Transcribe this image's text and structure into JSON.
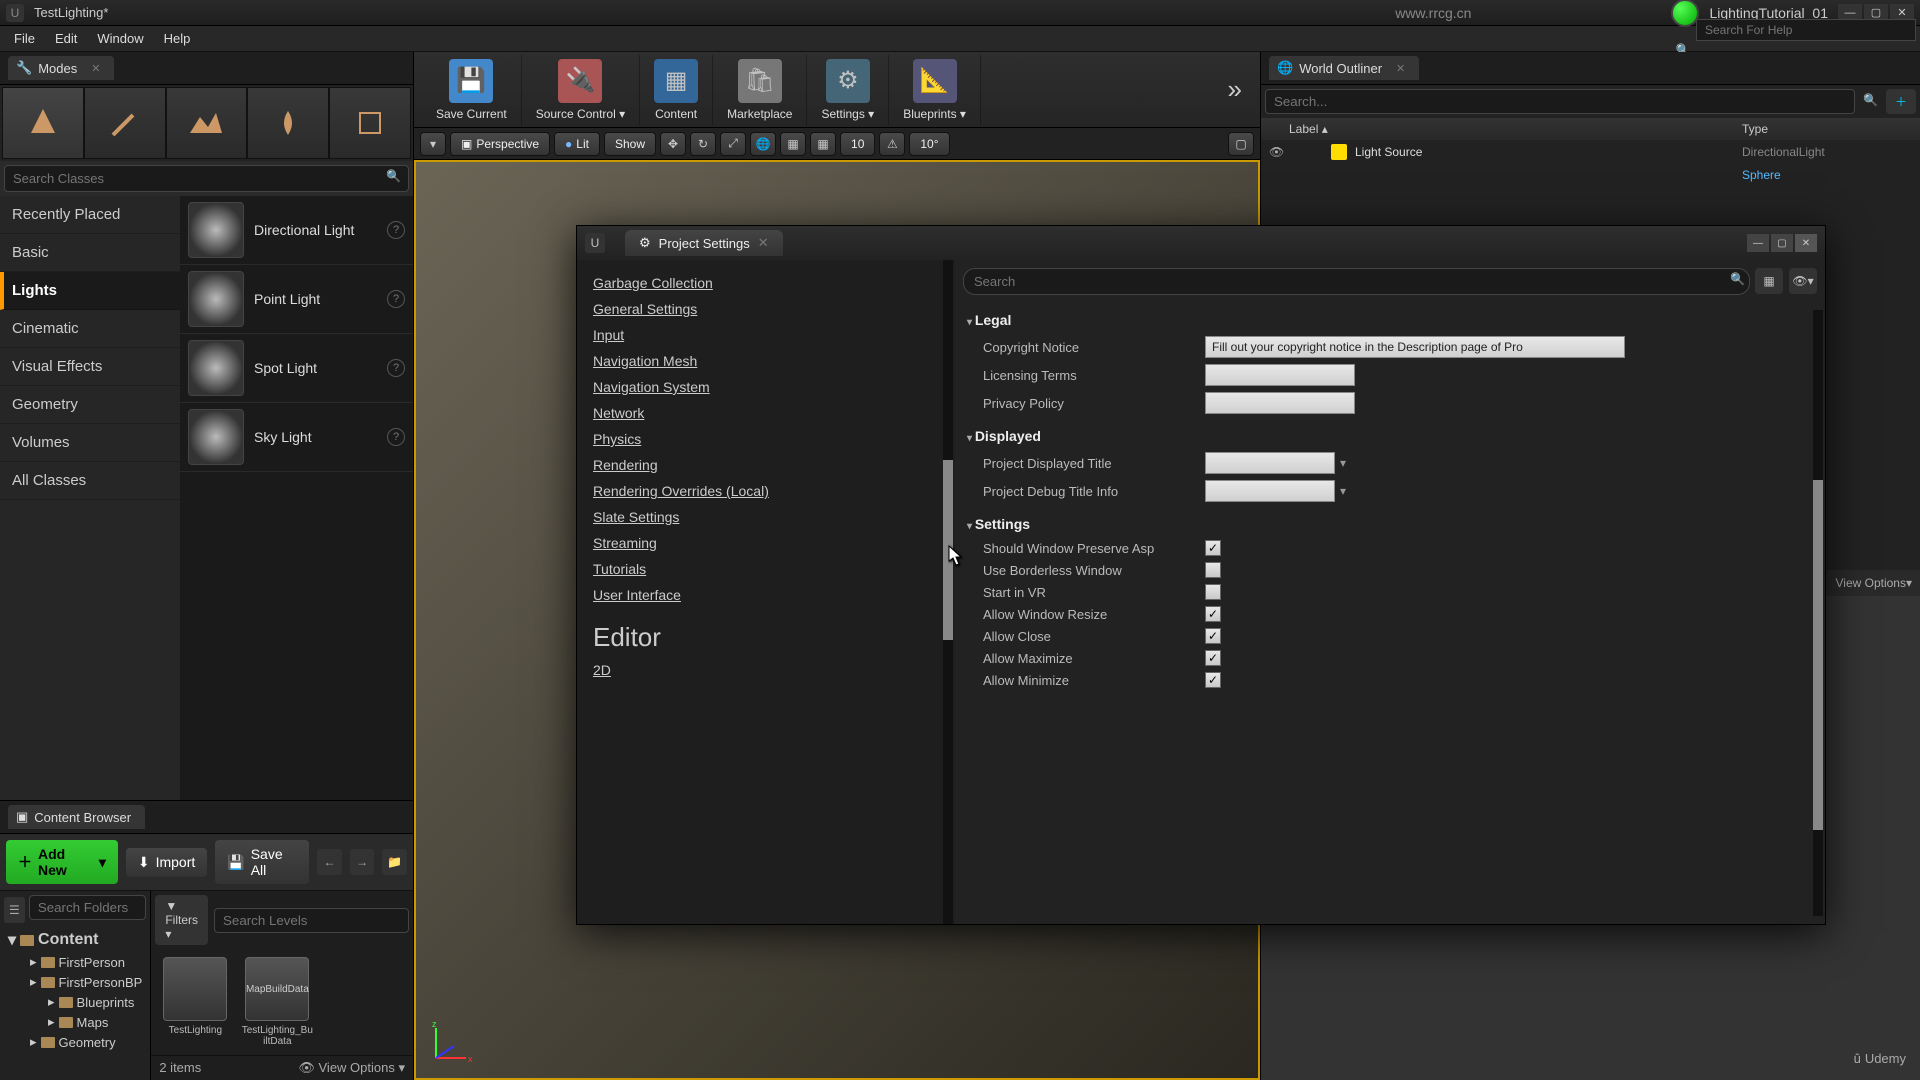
{
  "title": "TestLighting*",
  "url_watermark": "www.rrcg.cn",
  "project_name": "LightingTutorial_01",
  "menu": {
    "file": "File",
    "edit": "Edit",
    "window": "Window",
    "help": "Help"
  },
  "help_search_placeholder": "Search For Help",
  "modes": {
    "tab": "Modes",
    "search_placeholder": "Search Classes",
    "categories": [
      "Recently Placed",
      "Basic",
      "Lights",
      "Cinematic",
      "Visual Effects",
      "Geometry",
      "Volumes",
      "All Classes"
    ],
    "active_category_index": 2,
    "lights": [
      "Directional Light",
      "Point Light",
      "Spot Light",
      "Sky Light"
    ]
  },
  "toolbar": {
    "save": "Save Current",
    "source": "Source Control",
    "content": "Content",
    "market": "Marketplace",
    "settings": "Settings",
    "blueprints": "Blueprints"
  },
  "viewport": {
    "perspective": "Perspective",
    "lit": "Lit",
    "show": "Show",
    "snap1": "10",
    "snap2": "10°"
  },
  "outliner": {
    "tab": "World Outliner",
    "search_placeholder": "Search...",
    "col_label": "Label",
    "col_type": "Type",
    "rows": [
      {
        "name": "Light Source",
        "type": "DirectionalLight"
      }
    ],
    "extra_type": "Sphere",
    "view_options": "View Options"
  },
  "content_browser": {
    "tab": "Content Browser",
    "add_new": "Add New",
    "import": "Import",
    "save_all": "Save All",
    "filters": "Filters",
    "search_folders": "Search Folders",
    "search_levels": "Search Levels",
    "tree": {
      "root": "Content",
      "items": [
        "FirstPerson",
        "FirstPersonBP",
        "Blueprints",
        "Maps",
        "Geometry"
      ]
    },
    "assets": [
      {
        "name": "TestLighting"
      },
      {
        "name": "TestLighting_BuiltData",
        "badge": "MapBuildData"
      }
    ],
    "count": "2 items",
    "view_options": "View Options"
  },
  "project_settings": {
    "title": "Project Settings",
    "left_links": [
      "Garbage Collection",
      "General Settings",
      "Input",
      "Navigation Mesh",
      "Navigation System",
      "Network",
      "Physics",
      "Rendering",
      "Rendering Overrides (Local)",
      "Slate Settings",
      "Streaming",
      "Tutorials",
      "User Interface"
    ],
    "section2": "Editor",
    "section2_links": [
      "2D"
    ],
    "search_placeholder": "Search",
    "groups": {
      "legal": {
        "title": "Legal",
        "copyright_label": "Copyright Notice",
        "copyright_value": "Fill out your copyright notice in the Description page of Pro",
        "licensing_label": "Licensing Terms",
        "privacy_label": "Privacy Policy"
      },
      "displayed": {
        "title": "Displayed",
        "display_title_label": "Project Displayed Title",
        "debug_title_label": "Project Debug Title Info"
      },
      "settings": {
        "title": "Settings",
        "preserve_label": "Should Window Preserve Asp",
        "borderless_label": "Use Borderless Window",
        "startvr_label": "Start in VR",
        "resize_label": "Allow Window Resize",
        "close_label": "Allow Close",
        "max_label": "Allow Maximize",
        "min_label": "Allow Minimize",
        "preserve": true,
        "borderless": false,
        "startvr": false,
        "resize": true,
        "close": true,
        "max": true,
        "min": true
      }
    }
  },
  "brand": "Udemy"
}
